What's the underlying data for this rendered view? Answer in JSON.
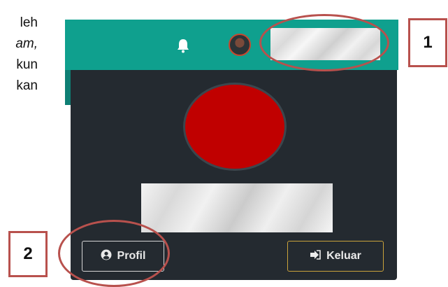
{
  "doc_fragment": {
    "line1": "leh",
    "line2": "am,",
    "line3": "kun",
    "line4": "kan"
  },
  "header": {
    "bell_icon": "bell-icon",
    "avatar": "user-avatar-small",
    "username_redacted": ""
  },
  "dropdown": {
    "avatar": "user-avatar-large",
    "fullname_redacted": "",
    "profile_button": {
      "label": "Profil",
      "icon": "user-circle-icon"
    },
    "logout_button": {
      "label": "Keluar",
      "icon": "sign-out-icon"
    }
  },
  "annotations": {
    "label_1": "1",
    "label_2": "2",
    "color": "#b8514d"
  },
  "colors": {
    "header_bg": "#0fa08e",
    "dropdown_bg": "#242a30",
    "avatar_red": "#c00000",
    "logout_border": "#caa23b"
  }
}
